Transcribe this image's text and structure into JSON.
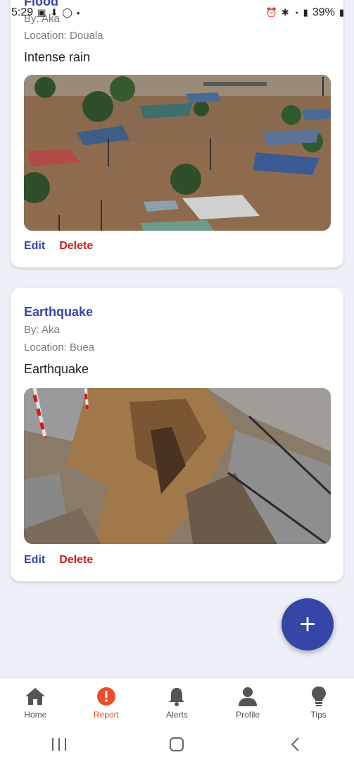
{
  "status_bar": {
    "time": "5:29",
    "battery": "39%"
  },
  "reports": [
    {
      "title": "Flood",
      "author": "By: Aka",
      "location": "Location: Douala",
      "description": "Intense rain",
      "image_icon": "flood-photo"
    },
    {
      "title": "Earthquake",
      "author": "By: Aka",
      "location": "Location: Buea",
      "description": "Earthquake",
      "image_icon": "earthquake-photo"
    }
  ],
  "actions": {
    "edit": "Edit",
    "delete": "Delete"
  },
  "fab": {
    "label": "+"
  },
  "bottom_nav": {
    "items": [
      {
        "label": "Home",
        "icon": "home-icon"
      },
      {
        "label": "Report",
        "icon": "report-alert-icon"
      },
      {
        "label": "Alerts",
        "icon": "bell-icon"
      },
      {
        "label": "Profile",
        "icon": "person-icon"
      },
      {
        "label": "Tips",
        "icon": "lightbulb-icon"
      }
    ],
    "active": "Report"
  },
  "colors": {
    "primary": "#3546a6",
    "danger": "#d11a1a",
    "active_tab": "#e8502b",
    "background": "#eef0f8"
  }
}
